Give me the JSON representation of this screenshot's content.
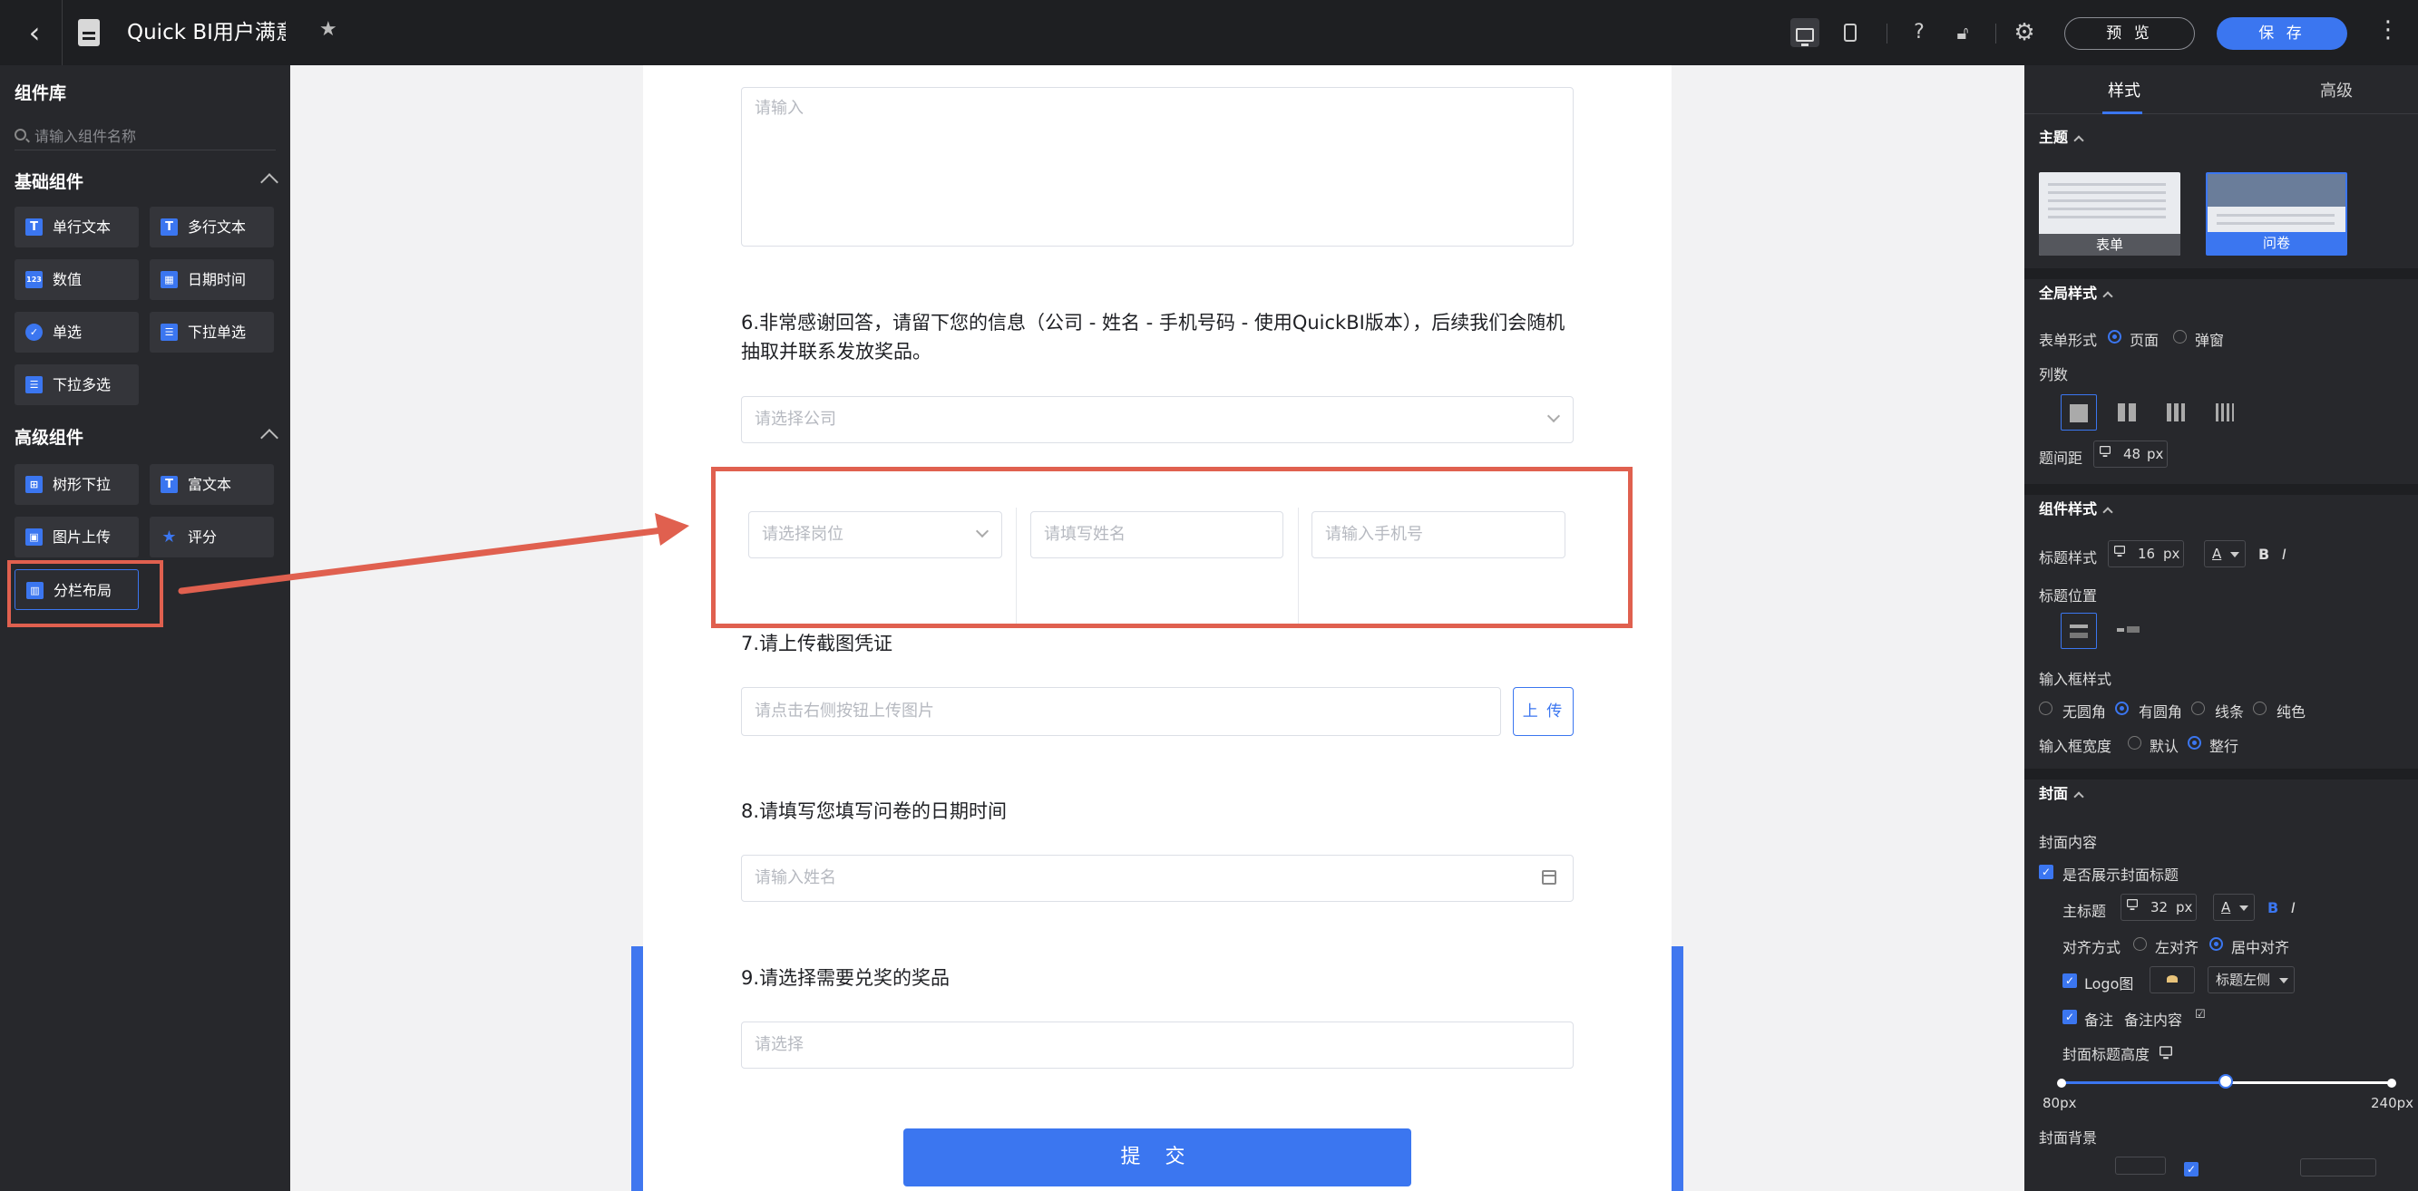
{
  "topbar": {
    "title": "Quick BI用户满意度调查",
    "preview_label": "预 览",
    "save_label": "保 存"
  },
  "left_panel": {
    "title": "组件库",
    "search_placeholder": "请输入组件名称",
    "basic_section": "基础组件",
    "basic_items": [
      {
        "label": "单行文本",
        "icon": "T"
      },
      {
        "label": "多行文本",
        "icon": "T"
      },
      {
        "label": "数值",
        "icon": "123"
      },
      {
        "label": "日期时间",
        "icon": "calendar"
      },
      {
        "label": "单选",
        "icon": "check-circle"
      },
      {
        "label": "下拉单选",
        "icon": "list"
      },
      {
        "label": "下拉多选",
        "icon": "list"
      }
    ],
    "advanced_section": "高级组件",
    "advanced_items": [
      {
        "label": "树形下拉",
        "icon": "tree"
      },
      {
        "label": "富文本",
        "icon": "T"
      },
      {
        "label": "图片上传",
        "icon": "image"
      },
      {
        "label": "评分",
        "icon": "star"
      },
      {
        "label": "分栏布局",
        "icon": "columns"
      }
    ]
  },
  "form": {
    "textarea_placeholder": "请输入",
    "q6": "6.非常感谢回答，请留下您的信息（公司 - 姓名 - 手机号码 - 使用QuickBI版本），后续我们会随机抽取并联系发放奖品。",
    "q6_company_placeholder": "请选择公司",
    "q6_position_placeholder": "请选择岗位",
    "q6_name_placeholder": "请填写姓名",
    "q6_phone_placeholder": "请输入手机号",
    "q7": "7.请上传截图凭证",
    "q7_placeholder": "请点击右侧按钮上传图片",
    "q7_upload": "上 传",
    "q8": "8.请填写您填写问卷的日期时间",
    "q8_placeholder": "请输入姓名",
    "q9": "9.请选择需要兑奖的奖品",
    "q9_placeholder": "请选择",
    "submit": "提 交"
  },
  "right_panel": {
    "tab_style": "样式",
    "tab_advanced": "高级",
    "theme_section": "主题",
    "theme_form": "表单",
    "theme_survey": "问卷",
    "global_section": "全局样式",
    "form_type_label": "表单形式",
    "form_type_page": "页面",
    "form_type_popup": "弹窗",
    "columns_label": "列数",
    "spacing_label": "题间距",
    "spacing_value": "48",
    "unit_px": "px",
    "component_section": "组件样式",
    "title_style_label": "标题样式",
    "title_font_size": "16",
    "title_color": "A",
    "bold": "B",
    "italic": "I",
    "title_position_label": "标题位置",
    "input_style_label": "输入框样式",
    "input_style_options": [
      "无圆角",
      "有圆角",
      "线条",
      "纯色"
    ],
    "input_width_label": "输入框宽度",
    "input_width_options": [
      "默认",
      "整行"
    ],
    "cover_section": "封面",
    "cover_content_label": "封面内容",
    "show_cover_title": "是否展示封面标题",
    "main_title_label": "主标题",
    "main_title_size": "32",
    "align_label": "对齐方式",
    "align_left": "左对齐",
    "align_center": "居中对齐",
    "logo_label": "Logo图",
    "logo_position": "标题左侧",
    "note_label": "备注",
    "note_content": "备注内容",
    "cover_height_label": "封面标题高度",
    "slider_min": "80px",
    "slider_max": "240px",
    "slider_fraction": 0.5,
    "cover_bg_label": "封面背景",
    "accent_color": "#3b76f0"
  }
}
